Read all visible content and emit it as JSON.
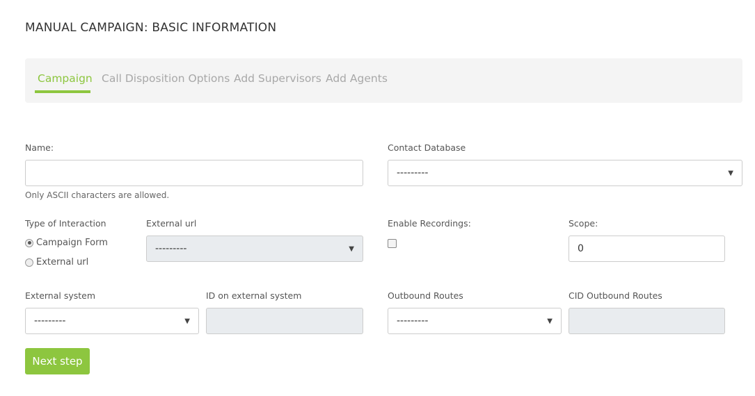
{
  "page_title": "MANUAL CAMPAIGN: BASIC INFORMATION",
  "tabs": [
    {
      "label": "Campaign",
      "active": true
    },
    {
      "label": "Call Disposition Options",
      "active": false
    },
    {
      "label": "Add Supervisors",
      "active": false
    },
    {
      "label": "Add Agents",
      "active": false
    }
  ],
  "form": {
    "name": {
      "label": "Name:",
      "value": "",
      "help": "Only ASCII characters are allowed."
    },
    "contact_database": {
      "label": "Contact Database",
      "value": "---------"
    },
    "type_of_interaction": {
      "label": "Type of Interaction",
      "options": [
        {
          "label": "Campaign Form",
          "selected": true
        },
        {
          "label": "External url",
          "selected": false
        }
      ]
    },
    "external_url": {
      "label": "External url",
      "value": "---------"
    },
    "enable_recordings": {
      "label": "Enable Recordings:",
      "checked": false
    },
    "scope": {
      "label": "Scope:",
      "value": "0"
    },
    "external_system": {
      "label": "External system",
      "value": "---------"
    },
    "id_external_system": {
      "label": "ID on external system",
      "value": ""
    },
    "outbound_routes": {
      "label": "Outbound Routes",
      "value": "---------"
    },
    "cid_outbound_routes": {
      "label": "CID Outbound Routes",
      "value": ""
    }
  },
  "next_button": "Next step",
  "colors": {
    "accent": "#8dc63f",
    "tab_bg": "#f4f4f4",
    "disabled_bg": "#e9ecef"
  }
}
